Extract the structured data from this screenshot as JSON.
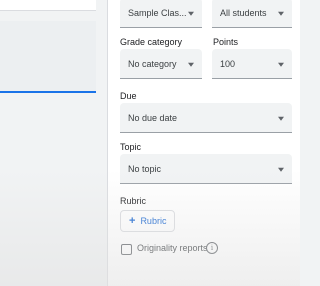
{
  "assign": {
    "for_class": "Sample Clas...",
    "for_students": "All students",
    "grade_category_label": "Grade category",
    "grade_category_value": "No category",
    "points_label": "Points",
    "points_value": "100",
    "due_label": "Due",
    "due_value": "No due date",
    "topic_label": "Topic",
    "topic_value": "No topic",
    "rubric_label": "Rubric",
    "rubric_button": "Rubric",
    "originality_label": "Originality reports",
    "info_glyph": "i",
    "plus_glyph": "+"
  },
  "colors": {
    "accent": "#1a73e8",
    "link": "#1967d2",
    "field_bg": "#f1f3f4"
  }
}
